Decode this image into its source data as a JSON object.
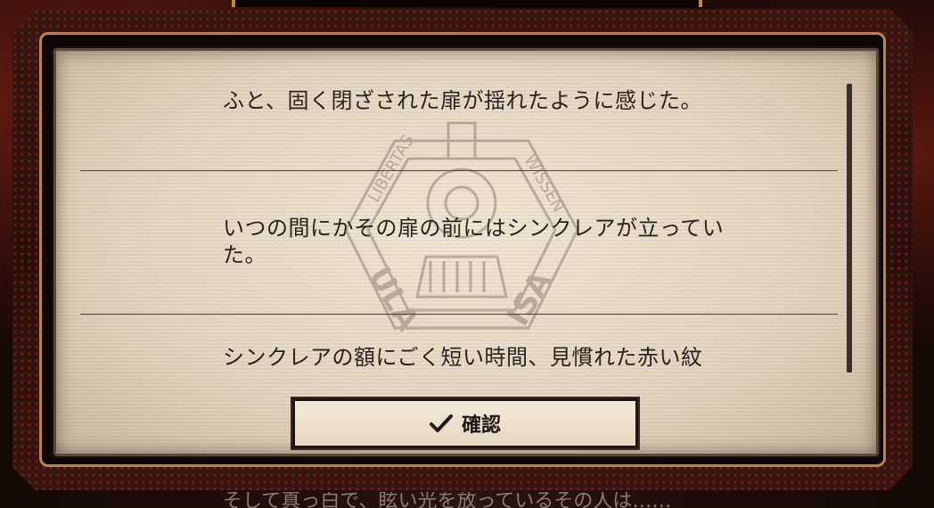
{
  "dialog": {
    "entries": [
      {
        "text": "ふと、固く閉ざされた扉が揺れたように感じた。"
      },
      {
        "text": "いつの間にかその扉の前にはシンクレアが立っていた。"
      },
      {
        "text": "シンクレアの額にごく短い時間、見慣れた赤い紋"
      }
    ],
    "confirm_label": "確認"
  },
  "background_text": "そして真っ白で、眩い光を放っているその人は……",
  "emblem": {
    "icon": "locomotive-emblem-icon",
    "left_text": "LIBERTAS",
    "right_text": "WISSEN",
    "lower_left": "ULA",
    "lower_right": "ISA"
  },
  "colors": {
    "panel": "#e9ddcb",
    "frame_accent": "#b8834d",
    "text": "#2a231d",
    "background": "#1c0f0c"
  }
}
